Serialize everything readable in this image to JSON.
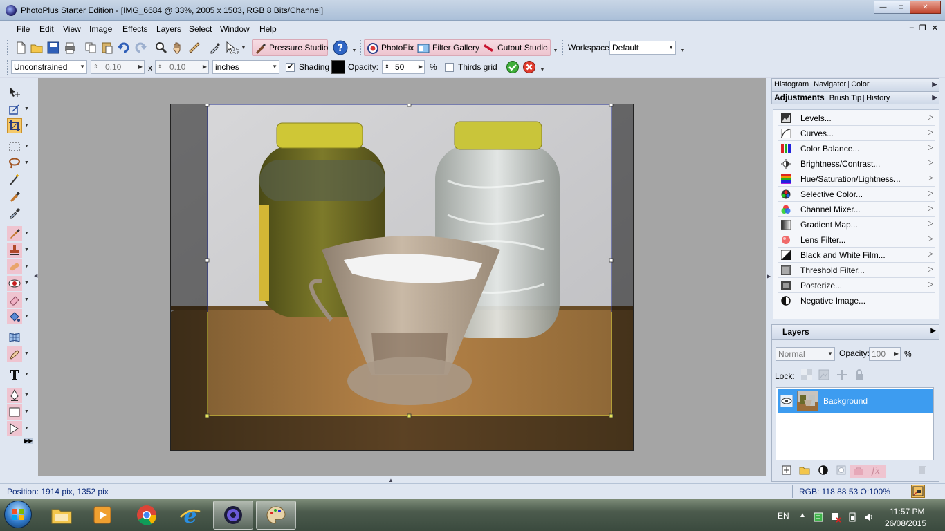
{
  "window": {
    "title": "PhotoPlus Starter Edition - [IMG_6684 @ 33%, 2005 x 1503, RGB 8 Bits/Channel]",
    "controls": {
      "minimize": "—",
      "maximize": "□",
      "close": "✕"
    }
  },
  "menu": {
    "items": [
      "File",
      "Edit",
      "View",
      "Image",
      "Effects",
      "Layers",
      "Select",
      "Window",
      "Help"
    ],
    "doc_controls": {
      "minimize": "–",
      "restore": "❐",
      "close": "✕"
    }
  },
  "toolbar1": {
    "pressure_studio": "Pressure Studio",
    "photofix": "PhotoFix",
    "filter_gallery": "Filter Gallery",
    "cutout_studio": "Cutout Studio",
    "workspace_label": "Workspace",
    "workspace_value": "Default"
  },
  "toolbar2": {
    "constraint": "Unconstrained",
    "width": "0.10",
    "x": "x",
    "height": "0.10",
    "units": "inches",
    "shading_label": "Shading",
    "shading_checked": "✔",
    "shading_color": "#000000",
    "opacity_label": "Opacity:",
    "opacity_value": "50",
    "percent": "%",
    "thirds_grid_label": "Thirds grid"
  },
  "panels": {
    "top_tabs": [
      "Histogram",
      "Navigator",
      "Color"
    ],
    "second_tabs": [
      "Adjustments",
      "Brush Tip",
      "History"
    ],
    "adjustments": [
      {
        "label": "Levels...",
        "icon": "levels-icon"
      },
      {
        "label": "Curves...",
        "icon": "curves-icon"
      },
      {
        "label": "Color Balance...",
        "icon": "color-balance-icon"
      },
      {
        "label": "Brightness/Contrast...",
        "icon": "brightness-icon"
      },
      {
        "label": "Hue/Saturation/Lightness...",
        "icon": "hue-icon"
      },
      {
        "label": "Selective Color...",
        "icon": "selective-color-icon"
      },
      {
        "label": "Channel Mixer...",
        "icon": "channel-mixer-icon"
      },
      {
        "label": "Gradient Map...",
        "icon": "gradient-map-icon"
      },
      {
        "label": "Lens Filter...",
        "icon": "lens-filter-icon"
      },
      {
        "label": "Black and White Film...",
        "icon": "bw-film-icon"
      },
      {
        "label": "Threshold Filter...",
        "icon": "threshold-icon"
      },
      {
        "label": "Posterize...",
        "icon": "posterize-icon"
      },
      {
        "label": "Negative Image...",
        "icon": "negative-icon"
      }
    ]
  },
  "layers": {
    "title": "Layers",
    "blend_mode": "Normal",
    "opacity_label": "Opacity:",
    "opacity_value": "100",
    "percent": "%",
    "lock_label": "Lock:",
    "layer_name": "Background"
  },
  "status": {
    "position": "Position: 1914 pix, 1352 pix",
    "rgb": "RGB: 118 88 53 O:100%"
  },
  "taskbar": {
    "language": "EN",
    "time": "11:57 PM",
    "date": "26/08/2015"
  },
  "colors": {
    "accent_pink": "#edc4cf",
    "selected_layer": "#3d9cf0",
    "active_tool": "#f5c96a"
  }
}
